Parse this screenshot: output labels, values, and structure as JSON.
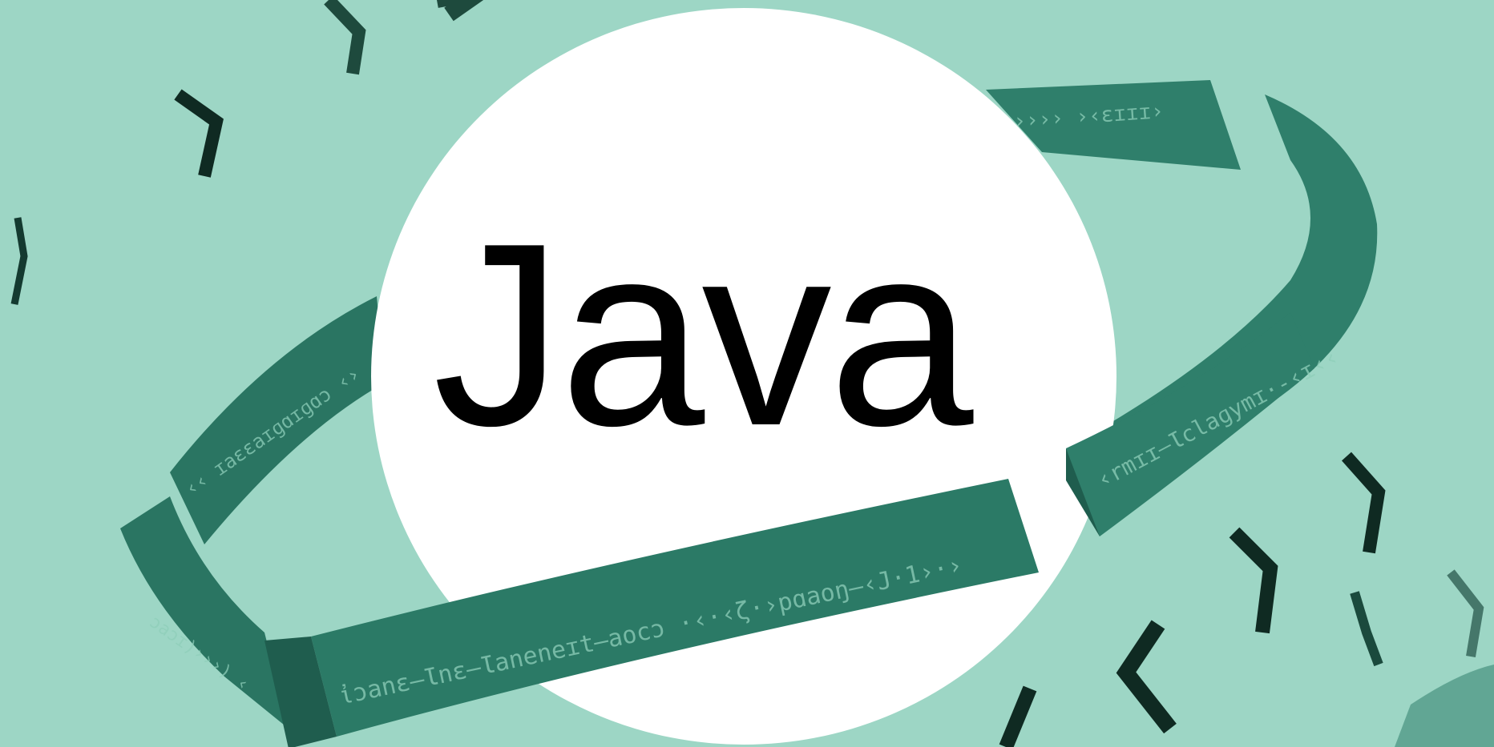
{
  "scene": {
    "title": "Java",
    "colors": {
      "background": "#9dd6c5",
      "disc": "#ffffff",
      "ribbon": "#2f7f6b",
      "ribbon_dark": "#1f5d4e",
      "bracket": "#0f2a22",
      "title": "#000000"
    },
    "ribbon_texts": {
      "front": "ἰɔanɛ–Ɩnɛ–Ɩaneneɪt–aocɔ ·‹·‹ζ·›pɑaoŋ–‹J·1›·›",
      "right": "‹rmɪɪ–Ɩclaɡymɪ·-‹ɪ‹‹",
      "top": "›››› ›‹ɛɪɪɪ›",
      "left": "‹‹ ɪaɛɛaɪɡɑɪɡɑɔ ‹›",
      "left_lower": "ɔaɔɪ)›››) ‹"
    }
  }
}
